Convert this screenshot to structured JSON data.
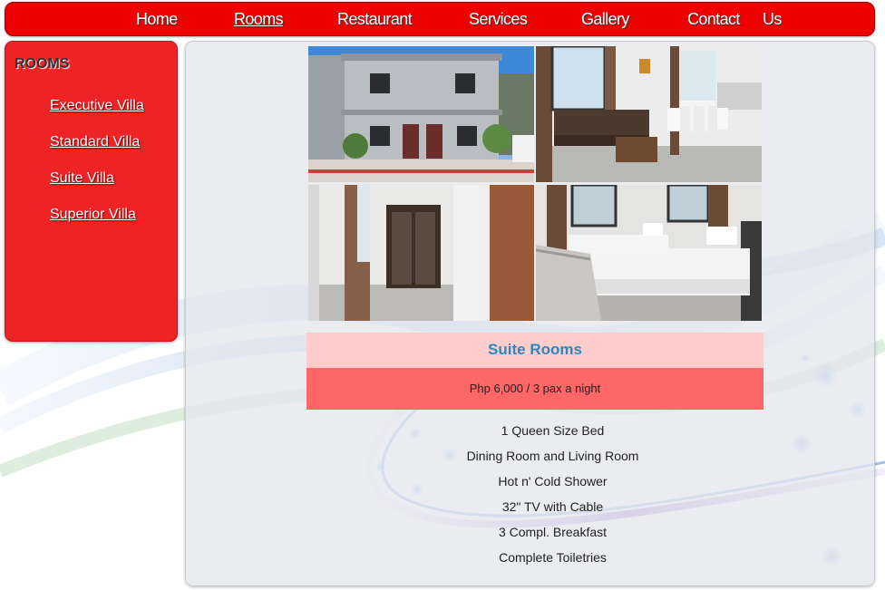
{
  "nav": {
    "items": [
      {
        "label": "Home",
        "active": false
      },
      {
        "label": "Rooms",
        "active": true
      },
      {
        "label": "Restaurant",
        "active": false
      },
      {
        "label": "Services",
        "active": false
      },
      {
        "label": "Gallery",
        "active": false
      },
      {
        "label": "Contact",
        "active": false
      },
      {
        "label": "Us",
        "active": false
      }
    ]
  },
  "sidebar": {
    "title": "ROOMS",
    "links": [
      {
        "label": "Executive Villa"
      },
      {
        "label": "Standard Villa"
      },
      {
        "label": "Suite Villa"
      },
      {
        "label": "Superior Villa"
      }
    ]
  },
  "room": {
    "title": "Suite Rooms",
    "price": "Php 6,000 / 3 pax a night",
    "amenities": [
      "1 Queen Size Bed",
      "Dining Room and Living Room",
      "Hot n' Cold Shower",
      "32\" TV with Cable",
      "3 Compl. Breakfast",
      "Complete Toiletries"
    ]
  },
  "photos": [
    {
      "subject": "building-exterior"
    },
    {
      "subject": "living-dining-room"
    },
    {
      "subject": "closet-hallway"
    },
    {
      "subject": "twin-bedroom"
    }
  ],
  "colors": {
    "nav_bg": "#ee0000",
    "sidebar_bg": "#ed2326",
    "title_box_bg": "#ffcccc",
    "price_box_bg": "#ff6666",
    "title_text": "#2a88bf"
  }
}
